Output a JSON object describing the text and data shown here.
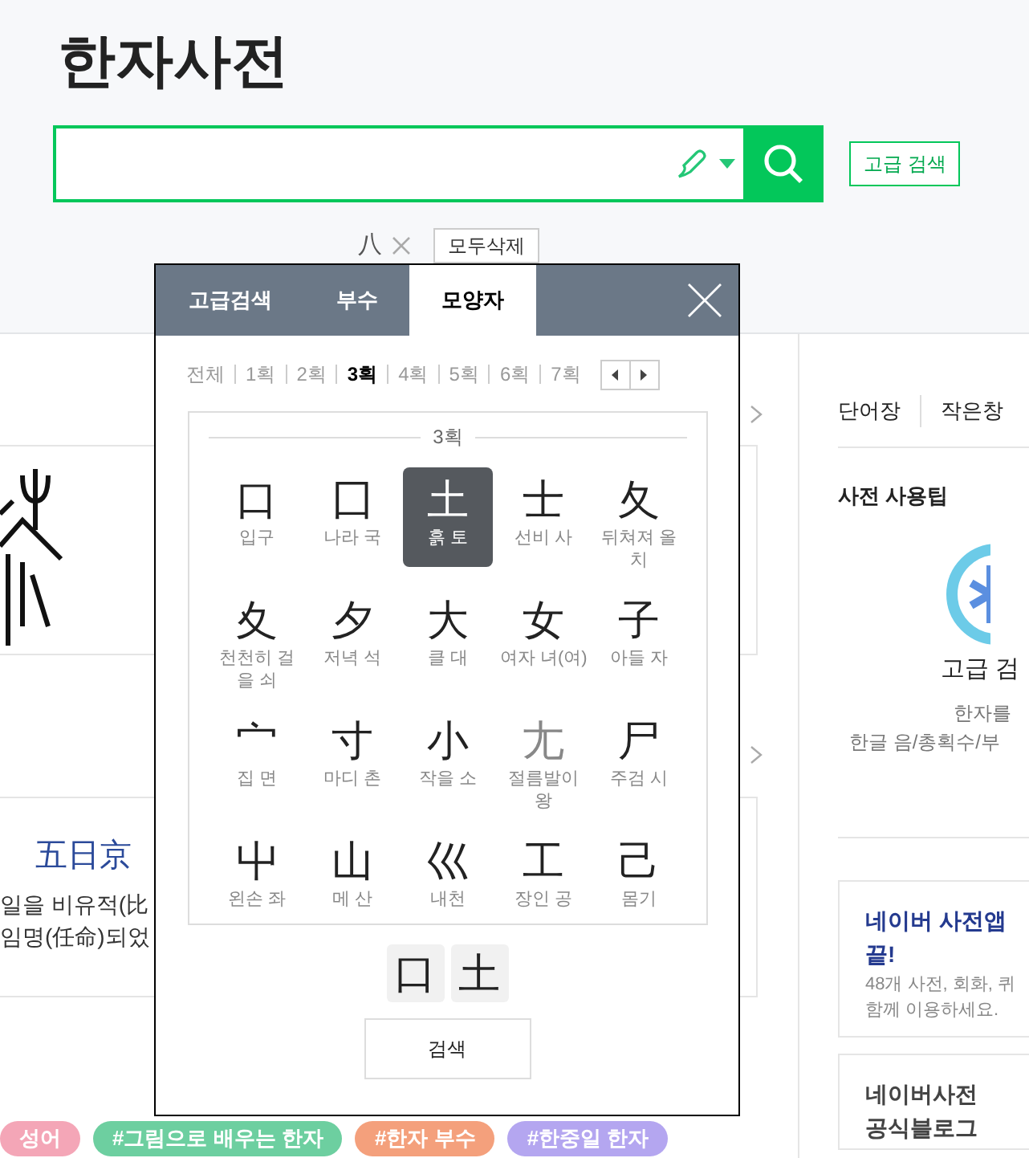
{
  "page_title": "한자사전",
  "advanced_search_button": "고급 검색",
  "query_chips": [
    {
      "text": "八"
    }
  ],
  "clear_all_button": "모두삭제",
  "popup": {
    "tabs": [
      {
        "label": "고급검색",
        "selected": false
      },
      {
        "label": "부수",
        "selected": false
      },
      {
        "label": "모양자",
        "selected": true
      }
    ],
    "stroke_filters": [
      {
        "label": "전체",
        "selected": false
      },
      {
        "label": "1획",
        "selected": false
      },
      {
        "label": "2획",
        "selected": false
      },
      {
        "label": "3획",
        "selected": true
      },
      {
        "label": "4획",
        "selected": false
      },
      {
        "label": "5획",
        "selected": false
      },
      {
        "label": "6획",
        "selected": false
      },
      {
        "label": "7획",
        "selected": false
      }
    ],
    "group_heading": "3획",
    "shapes": [
      {
        "char": "口",
        "label": "입구",
        "selected": false,
        "dim": false
      },
      {
        "char": "囗",
        "label": "나라 국",
        "selected": false,
        "dim": false
      },
      {
        "char": "土",
        "label": "흙 토",
        "selected": true,
        "dim": false
      },
      {
        "char": "士",
        "label": "선비 사",
        "selected": false,
        "dim": false
      },
      {
        "char": "夂",
        "label": "뒤쳐져 올 치",
        "selected": false,
        "dim": false
      },
      {
        "char": "夊",
        "label": "천천히 걸을 쇠",
        "selected": false,
        "dim": false
      },
      {
        "char": "夕",
        "label": "저녁 석",
        "selected": false,
        "dim": false
      },
      {
        "char": "大",
        "label": "클 대",
        "selected": false,
        "dim": false
      },
      {
        "char": "女",
        "label": "여자 녀(여)",
        "selected": false,
        "dim": false
      },
      {
        "char": "子",
        "label": "아들 자",
        "selected": false,
        "dim": false
      },
      {
        "char": "宀",
        "label": "집 면",
        "selected": false,
        "dim": false
      },
      {
        "char": "寸",
        "label": "마디 촌",
        "selected": false,
        "dim": false
      },
      {
        "char": "小",
        "label": "작을 소",
        "selected": false,
        "dim": false
      },
      {
        "char": "尢",
        "label": "절름발이 왕",
        "selected": false,
        "dim": true
      },
      {
        "char": "尸",
        "label": "주검 시",
        "selected": false,
        "dim": false
      },
      {
        "char": "屮",
        "label": "왼손 좌",
        "selected": false,
        "dim": false
      },
      {
        "char": "山",
        "label": "메 산",
        "selected": false,
        "dim": false
      },
      {
        "char": "巛",
        "label": "내천",
        "selected": false,
        "dim": false
      },
      {
        "char": "工",
        "label": "장인 공",
        "selected": false,
        "dim": false
      },
      {
        "char": "己",
        "label": "몸기",
        "selected": false,
        "dim": false
      }
    ],
    "picked": [
      "口",
      "土"
    ],
    "search_button": "검색"
  },
  "left": {
    "idiom": "五日京",
    "lines": [
      "일을 비유적(比",
      "임명(任命)되었"
    ],
    "tags": [
      {
        "text": "성어",
        "color": "#f4a6b7"
      },
      {
        "text": "#그림으로 배우는 한자",
        "color": "#6dcfa0"
      },
      {
        "text": "#한자 부수",
        "color": "#f4a07c"
      },
      {
        "text": "#한중일 한자",
        "color": "#b4a6f0"
      }
    ]
  },
  "sidebar": {
    "links": [
      "단어장",
      "작은창"
    ],
    "tips_title": "사전 사용팁",
    "tip_title": "고급 검",
    "tip_lines": [
      "한자를",
      "한글 음/총획수/부"
    ],
    "promo": {
      "title": "네이버 사전앱",
      "title_line2": "끝!",
      "lines": [
        "48개 사전, 회화, 퀴",
        "함께 이용하세요."
      ]
    },
    "blog": [
      "네이버사전",
      "공식블로그"
    ]
  }
}
